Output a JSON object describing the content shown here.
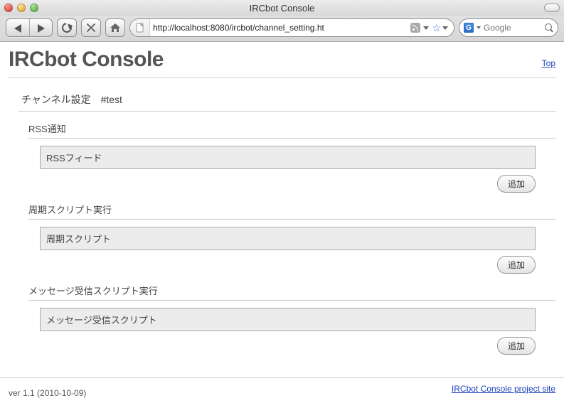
{
  "window": {
    "title": "IRCbot Console"
  },
  "toolbar": {
    "url": "http://localhost:8080/ircbot/channel_setting.ht",
    "search_placeholder": "Google"
  },
  "page": {
    "title": "IRCbot Console",
    "top_link": "Top",
    "section_heading": "チャンネル設定　#test",
    "groups": [
      {
        "label": "RSS通知",
        "field_header": "RSSフィード",
        "add_label": "追加"
      },
      {
        "label": "周期スクリプト実行",
        "field_header": "周期スクリプト",
        "add_label": "追加"
      },
      {
        "label": "メッセージ受信スクリプト実行",
        "field_header": "メッセージ受信スクリプト",
        "add_label": "追加"
      }
    ],
    "footer_link": "IRCbot Console project site",
    "version": "ver 1.1 (2010-10-09)"
  }
}
